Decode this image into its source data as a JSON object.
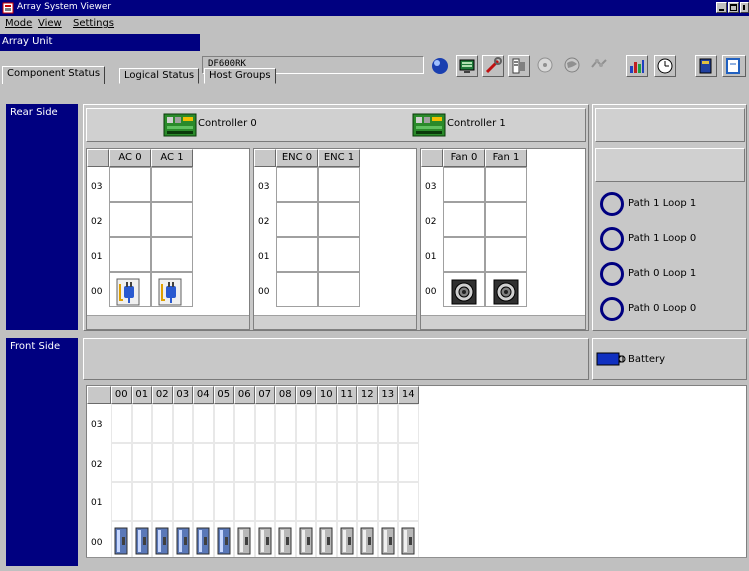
{
  "window": {
    "title": "Array System Viewer"
  },
  "menu": {
    "items": [
      {
        "label": "Mode"
      },
      {
        "label": "View"
      },
      {
        "label": "Settings"
      }
    ]
  },
  "unit": {
    "label": "Array Unit",
    "value": "DF600RK"
  },
  "toolbar": [
    {
      "icon": "status-ball-icon",
      "enabled": true
    },
    {
      "icon": "monitor-icon",
      "enabled": true
    },
    {
      "icon": "wrench-icon",
      "enabled": true
    },
    {
      "icon": "config-icon",
      "enabled": true
    },
    {
      "icon": "disk-icon",
      "enabled": false
    },
    {
      "icon": "globe-icon",
      "enabled": false
    },
    {
      "icon": "network-icon",
      "enabled": false
    },
    {
      "icon": "chart-icon",
      "enabled": true
    },
    {
      "icon": "clock-icon",
      "enabled": true
    },
    {
      "icon": "book-icon",
      "enabled": true
    },
    {
      "icon": "document-icon",
      "enabled": true
    }
  ],
  "tabs": [
    {
      "label": "Component Status",
      "active": true
    },
    {
      "label": "Logical Status",
      "active": false
    },
    {
      "label": "Host Groups",
      "active": false
    }
  ],
  "rear": {
    "label": "Rear Side",
    "controllers": [
      "Controller 0",
      "Controller 1"
    ],
    "row_labels": [
      "03",
      "02",
      "01",
      "00"
    ],
    "groups": [
      {
        "columns": [
          "AC 0",
          "AC 1"
        ],
        "row00_icon": "power-plug-icon"
      },
      {
        "columns": [
          "ENC 0",
          "ENC 1"
        ],
        "row00_icon": ""
      },
      {
        "columns": [
          "Fan 0",
          "Fan 1"
        ],
        "row00_icon": "fan-icon"
      }
    ],
    "paths": [
      "Path 1  Loop 1",
      "Path 1  Loop 0",
      "Path 0  Loop 1",
      "Path 0  Loop 0"
    ]
  },
  "front": {
    "label": "Front Side",
    "battery_label": "Battery",
    "columns": [
      "00",
      "01",
      "02",
      "03",
      "04",
      "05",
      "06",
      "07",
      "08",
      "09",
      "10",
      "11",
      "12",
      "13",
      "14"
    ],
    "row_labels": [
      "03",
      "02",
      "01",
      "00"
    ],
    "drives_row00": [
      "active",
      "active",
      "active",
      "active",
      "active",
      "active",
      "standby",
      "standby",
      "standby",
      "standby",
      "standby",
      "standby",
      "standby",
      "standby",
      "standby"
    ]
  },
  "colors": {
    "title_bar": "#000080",
    "path_ring": "#000080",
    "drive_active": "#5a78b8",
    "drive_standby": "#b8b8b8"
  }
}
